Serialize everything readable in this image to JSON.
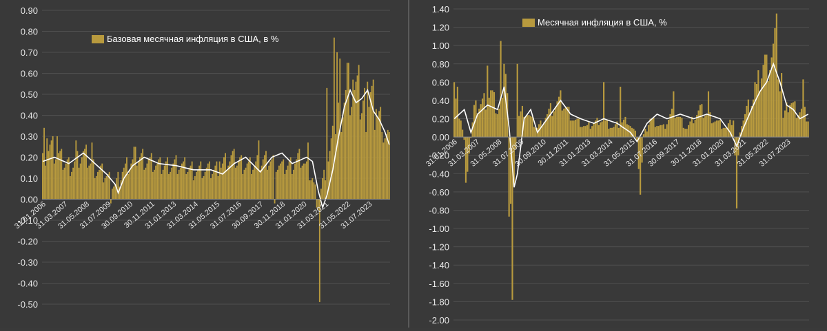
{
  "colors": {
    "bar": "#b89a3e",
    "line": "#ffffff",
    "grid": "#505050",
    "text": "#e6e6e6",
    "background": "#393939"
  },
  "chart_data": [
    {
      "type": "bar",
      "title": "",
      "legend": "Базовая месячная инфляция в США, в %",
      "legend_position": "top-left",
      "grid": true,
      "ylim": [
        -0.5,
        0.9
      ],
      "yticks": [
        "0.90",
        "0.80",
        "0.70",
        "0.60",
        "0.50",
        "0.40",
        "0.30",
        "0.20",
        "0.10",
        "0.00",
        "-0.10",
        "-0.20",
        "-0.30",
        "-0.40",
        "-0.50"
      ],
      "xtick_labels": [
        "31.01.2006",
        "31.03.2007",
        "31.05.2008",
        "31.07.2009",
        "30.09.2010",
        "30.11.2011",
        "31.01.2013",
        "31.03.2014",
        "31.05.2015",
        "31.07.2016",
        "30.09.2017",
        "30.11.2018",
        "31.01.2020",
        "31.03.2021",
        "31.05.2022",
        "31.07.2023"
      ],
      "keypoints": [
        [
          0,
          0.2
        ],
        [
          5,
          0.26
        ],
        [
          14,
          0.18
        ],
        [
          20,
          0.16
        ],
        [
          28,
          0.22
        ],
        [
          36,
          0.15
        ],
        [
          44,
          0.12
        ],
        [
          50,
          0.07
        ],
        [
          55,
          0.14
        ],
        [
          66,
          0.21
        ],
        [
          80,
          0.16
        ],
        [
          92,
          0.17
        ],
        [
          105,
          0.14
        ],
        [
          118,
          0.14
        ],
        [
          130,
          0.2
        ],
        [
          142,
          0.16
        ],
        [
          156,
          0.2
        ],
        [
          166,
          0.15
        ],
        [
          178,
          0.2
        ],
        [
          186,
          0.1
        ],
        [
          190,
          -0.02
        ],
        [
          192,
          0.05
        ],
        [
          196,
          0.16
        ],
        [
          200,
          0.28
        ],
        [
          204,
          0.42
        ],
        [
          208,
          0.5
        ],
        [
          212,
          0.54
        ],
        [
          216,
          0.48
        ],
        [
          220,
          0.42
        ],
        [
          226,
          0.5
        ],
        [
          232,
          0.4
        ],
        [
          238,
          0.3
        ],
        [
          239,
          0.27
        ]
      ],
      "spikes": [
        [
          1,
          0.34
        ],
        [
          3,
          0.29
        ],
        [
          10,
          0.3
        ],
        [
          23,
          0.28
        ],
        [
          34,
          0.27
        ],
        [
          47,
          -0.02
        ],
        [
          63,
          0.25
        ],
        [
          122,
          0.18
        ],
        [
          149,
          0.28
        ],
        [
          160,
          -0.02
        ],
        [
          183,
          0.27
        ],
        [
          191,
          -0.49
        ],
        [
          196,
          0.53
        ],
        [
          201,
          0.77
        ],
        [
          203,
          0.7
        ],
        [
          205,
          0.67
        ],
        [
          210,
          0.65
        ],
        [
          214,
          0.57
        ],
        [
          218,
          0.64
        ],
        [
          224,
          0.56
        ],
        [
          230,
          0.43
        ],
        [
          234,
          0.32
        ]
      ],
      "line_keypoints": [
        [
          0,
          0.18
        ],
        [
          8,
          0.2
        ],
        [
          18,
          0.17
        ],
        [
          28,
          0.22
        ],
        [
          36,
          0.17
        ],
        [
          44,
          0.12
        ],
        [
          50,
          0.07
        ],
        [
          52,
          0.03
        ],
        [
          56,
          0.1
        ],
        [
          62,
          0.16
        ],
        [
          70,
          0.2
        ],
        [
          80,
          0.17
        ],
        [
          92,
          0.16
        ],
        [
          104,
          0.14
        ],
        [
          116,
          0.14
        ],
        [
          124,
          0.12
        ],
        [
          132,
          0.17
        ],
        [
          140,
          0.2
        ],
        [
          150,
          0.13
        ],
        [
          158,
          0.2
        ],
        [
          165,
          0.22
        ],
        [
          172,
          0.17
        ],
        [
          182,
          0.2
        ],
        [
          186,
          0.18
        ],
        [
          190,
          0.04
        ],
        [
          193,
          -0.04
        ],
        [
          196,
          0.02
        ],
        [
          200,
          0.14
        ],
        [
          204,
          0.3
        ],
        [
          208,
          0.44
        ],
        [
          212,
          0.52
        ],
        [
          216,
          0.46
        ],
        [
          220,
          0.48
        ],
        [
          224,
          0.52
        ],
        [
          228,
          0.42
        ],
        [
          232,
          0.38
        ],
        [
          236,
          0.32
        ],
        [
          239,
          0.26
        ]
      ]
    },
    {
      "type": "bar",
      "title": "",
      "legend": "Месячная инфляция в США, %",
      "legend_position": "top-left",
      "grid": true,
      "ylim": [
        -2.0,
        1.4
      ],
      "yticks": [
        "1.40",
        "1.20",
        "1.00",
        "0.80",
        "0.60",
        "0.40",
        "0.20",
        "0.00",
        "-0.20",
        "-0.40",
        "-0.60",
        "-0.80",
        "-1.00",
        "-1.20",
        "-1.40",
        "-1.60",
        "-1.80",
        "-2.00"
      ],
      "xtick_labels": [
        "31.01.2006",
        "31.03.2007",
        "31.05.2008",
        "31.07.2009",
        "30.09.2010",
        "30.11.2011",
        "31.01.2013",
        "31.03.2014",
        "31.05.2015",
        "31.07.2016",
        "30.09.2017",
        "30.11.2018",
        "31.01.2020",
        "31.03.2021",
        "31.05.2022",
        "31.07.2023"
      ],
      "keypoints": [
        [
          0,
          0.4
        ],
        [
          4,
          0.2
        ],
        [
          8,
          -0.3
        ],
        [
          12,
          0.3
        ],
        [
          18,
          0.4
        ],
        [
          22,
          0.5
        ],
        [
          26,
          0.3
        ],
        [
          30,
          0.4
        ],
        [
          31,
          0.9
        ],
        [
          33,
          0.2
        ],
        [
          34,
          -0.8
        ],
        [
          35,
          -1.7
        ],
        [
          36,
          -0.4
        ],
        [
          38,
          0.2
        ],
        [
          42,
          0.3
        ],
        [
          50,
          0.1
        ],
        [
          58,
          0.3
        ],
        [
          64,
          0.4
        ],
        [
          72,
          0.2
        ],
        [
          80,
          0.1
        ],
        [
          88,
          0.2
        ],
        [
          96,
          0.1
        ],
        [
          104,
          0.2
        ],
        [
          110,
          0.0
        ],
        [
          112,
          -0.6
        ],
        [
          114,
          0.0
        ],
        [
          118,
          0.2
        ],
        [
          126,
          0.1
        ],
        [
          132,
          0.3
        ],
        [
          140,
          0.1
        ],
        [
          148,
          0.3
        ],
        [
          156,
          0.2
        ],
        [
          164,
          0.1
        ],
        [
          168,
          0.2
        ],
        [
          170,
          -0.6
        ],
        [
          172,
          0.1
        ],
        [
          176,
          0.3
        ],
        [
          182,
          0.5
        ],
        [
          186,
          0.8
        ],
        [
          190,
          0.9
        ],
        [
          194,
          1.1
        ],
        [
          196,
          0.6
        ],
        [
          198,
          0.2
        ],
        [
          202,
          0.4
        ],
        [
          206,
          0.3
        ],
        [
          210,
          0.3
        ],
        [
          213,
          0.2
        ]
      ],
      "spikes": [
        [
          0,
          0.6
        ],
        [
          2,
          0.55
        ],
        [
          7,
          -0.5
        ],
        [
          20,
          0.78
        ],
        [
          28,
          1.05
        ],
        [
          30,
          0.8
        ],
        [
          33,
          -0.87
        ],
        [
          35,
          -1.78
        ],
        [
          38,
          0.8
        ],
        [
          90,
          0.6
        ],
        [
          100,
          0.55
        ],
        [
          132,
          0.5
        ],
        [
          153,
          0.5
        ],
        [
          170,
          -0.78
        ],
        [
          181,
          0.6
        ],
        [
          188,
          0.9
        ],
        [
          193,
          1.19
        ],
        [
          197,
          0.7
        ],
        [
          210,
          0.63
        ]
      ],
      "line_keypoints": [
        [
          0,
          0.2
        ],
        [
          6,
          0.3
        ],
        [
          10,
          0.05
        ],
        [
          14,
          0.25
        ],
        [
          20,
          0.35
        ],
        [
          26,
          0.3
        ],
        [
          30,
          0.55
        ],
        [
          33,
          0.1
        ],
        [
          36,
          -0.55
        ],
        [
          38,
          -0.4
        ],
        [
          42,
          0.2
        ],
        [
          46,
          0.3
        ],
        [
          50,
          0.05
        ],
        [
          58,
          0.25
        ],
        [
          64,
          0.4
        ],
        [
          70,
          0.25
        ],
        [
          76,
          0.2
        ],
        [
          84,
          0.15
        ],
        [
          90,
          0.2
        ],
        [
          98,
          0.15
        ],
        [
          106,
          0.05
        ],
        [
          110,
          -0.05
        ],
        [
          116,
          0.15
        ],
        [
          122,
          0.25
        ],
        [
          128,
          0.2
        ],
        [
          136,
          0.25
        ],
        [
          144,
          0.2
        ],
        [
          152,
          0.25
        ],
        [
          160,
          0.2
        ],
        [
          166,
          0.05
        ],
        [
          170,
          -0.1
        ],
        [
          174,
          0.1
        ],
        [
          180,
          0.35
        ],
        [
          184,
          0.5
        ],
        [
          188,
          0.6
        ],
        [
          192,
          0.8
        ],
        [
          196,
          0.6
        ],
        [
          200,
          0.35
        ],
        [
          204,
          0.3
        ],
        [
          208,
          0.2
        ],
        [
          213,
          0.25
        ]
      ]
    }
  ]
}
